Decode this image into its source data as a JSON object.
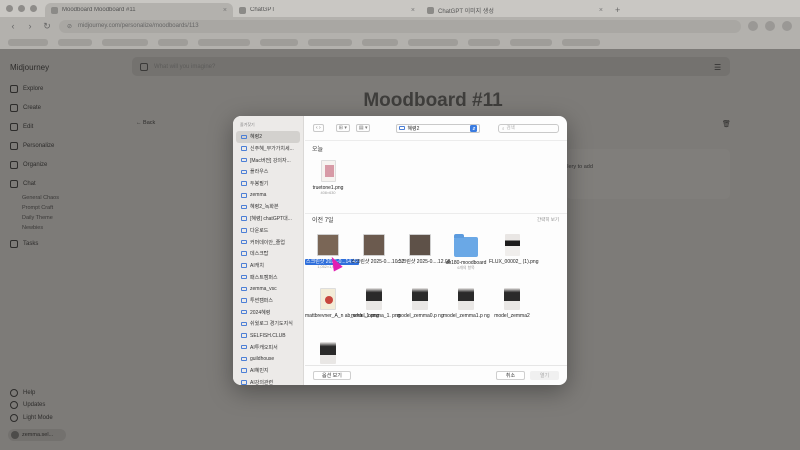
{
  "browser": {
    "tabs": [
      {
        "label": "Moodboard Moodboard #11",
        "active": true
      },
      {
        "label": "ChatGPT",
        "active": false
      },
      {
        "label": "ChatGPT 이미지 생성",
        "active": false
      }
    ],
    "url": "midjourney.com/personalize/moodboards/113"
  },
  "sidebar": {
    "logo": "Midjourney",
    "items": [
      {
        "label": "Explore",
        "icon": "compass-icon"
      },
      {
        "label": "Create",
        "icon": "pencil-icon"
      },
      {
        "label": "Edit",
        "icon": "edit-icon"
      },
      {
        "label": "Personalize",
        "icon": "palette-icon"
      },
      {
        "label": "Organize",
        "icon": "folder-icon"
      },
      {
        "label": "Chat",
        "icon": "chat-icon"
      }
    ],
    "chat_channels": [
      "General Chaos",
      "Prompt Craft",
      "Daily Theme",
      "Newbies"
    ],
    "tasks": "Tasks",
    "bottom": [
      {
        "label": "Help",
        "icon": "help-icon"
      },
      {
        "label": "Updates",
        "icon": "bell-icon"
      },
      {
        "label": "Light Mode",
        "icon": "sun-icon"
      }
    ],
    "user": "zemma.sel..."
  },
  "main": {
    "search_placeholder": "What will you imagine?",
    "title": "Moodboard #11",
    "back_label": "Back",
    "drop_hint": "llery to add"
  },
  "dialog": {
    "sidebar_heading": "즐겨찾기",
    "folders": [
      "혜령2",
      "신주혜_부가가치세...",
      "[Mac버전] 강의자...",
      "플라우스",
      "두봉필기",
      "zemma",
      "혜령2_녹화본",
      "[혜령] chatGPT대...",
      "다운로드",
      "커머데이안_졸업",
      "데스크탑",
      "AI캐치",
      "패스트캠퍼스",
      "zemma_vsc",
      "투썬캠퍼스",
      "2024혜령",
      "쉬웠로그 경기도지식",
      "SELFISH.CLUB",
      "AI투캐오피서",
      "guildhouse",
      "AI혜민지",
      "AI강의관련"
    ],
    "selected_folder_index": 0,
    "current_path": "혜령2",
    "search_placeholder": "검색",
    "section_today": "오늘",
    "section_prev": "이전 7일",
    "show_more": "간략히 보기",
    "today_files": [
      {
        "name": "truetone1.png",
        "meta": "408×630"
      }
    ],
    "prev_files": [
      {
        "name": "스크린샷 2025-0...14.42",
        "meta": "1,052×1,078",
        "selected": true
      },
      {
        "name": "스크린샷 2025-0....10.32",
        "meta": ""
      },
      {
        "name": "스크린샷 2025-0....12.08",
        "meta": ""
      },
      {
        "name": "ab180-moodboard",
        "meta": "6개의 항목"
      },
      {
        "name": "FLUX_00002_ (1).png",
        "meta": ""
      },
      {
        "name": "mattbrevner_A_n ab_who...1.png",
        "meta": ""
      },
      {
        "name": "model_zemma_1. png",
        "meta": ""
      },
      {
        "name": "model_zemma0.p ng",
        "meta": ""
      },
      {
        "name": "model_zemma1.p ng",
        "meta": ""
      },
      {
        "name": "model_zemma2",
        "meta": ""
      },
      {
        "name": "",
        "meta": ""
      }
    ],
    "options_label": "옵션 보기",
    "cancel_label": "취소",
    "open_label": "열기"
  }
}
